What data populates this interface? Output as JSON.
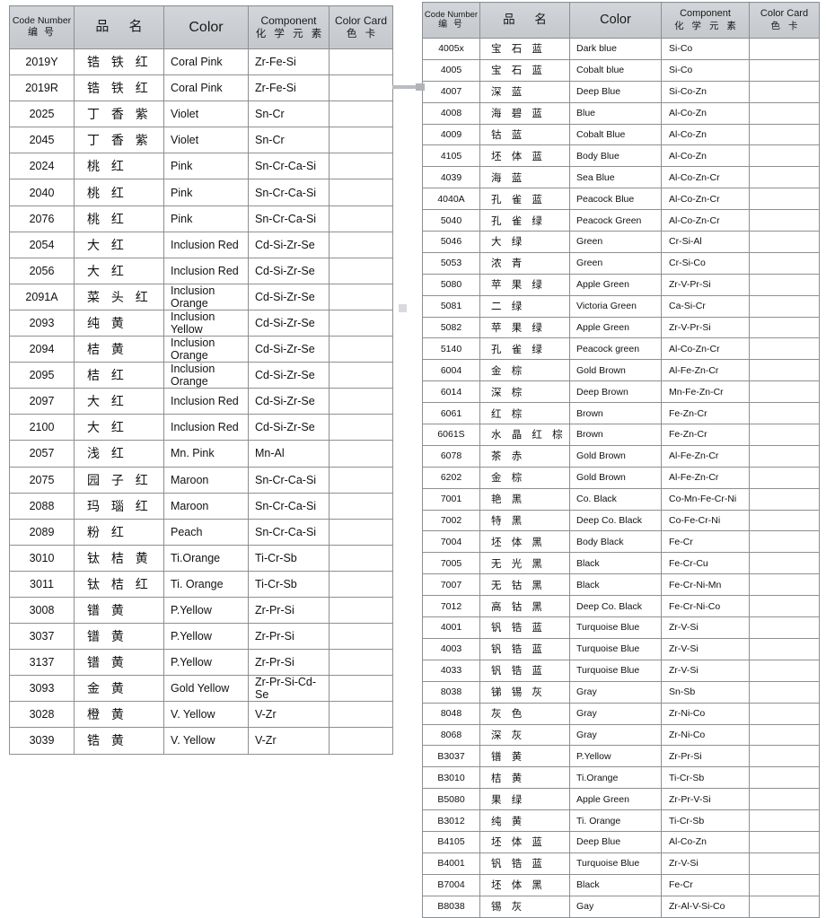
{
  "document": {
    "title": "Ceramic Pigment Color Chart",
    "tables": [
      {
        "id": "left-table",
        "headers": {
          "code": {
            "en": "Code Number",
            "cn": "编 号"
          },
          "name": {
            "en": "",
            "cn": "品    名"
          },
          "color": {
            "en": "Color",
            "cn": ""
          },
          "component": {
            "en": "Component",
            "cn": "化 学 元 素"
          },
          "card": {
            "en": "Color Card",
            "cn": "色 卡"
          }
        },
        "rows": [
          {
            "code": "2019Y",
            "name": "锆 铁 红",
            "color": "Coral Pink",
            "component": "Zr-Fe-Si",
            "swatch": "#c55a22"
          },
          {
            "code": "2019R",
            "name": "锆 铁 红",
            "color": "Coral Pink",
            "component": "Zr-Fe-Si",
            "swatch": "#c43b1c"
          },
          {
            "code": "2025",
            "name": "丁 香 紫",
            "color": "Violet",
            "component": "Sn-Cr",
            "swatch": "#a7689f"
          },
          {
            "code": "2045",
            "name": "丁 香 紫",
            "color": "Violet",
            "component": "Sn-Cr",
            "swatch": "#9b579b"
          },
          {
            "code": "2024",
            "name": "桃 红",
            "color": "Pink",
            "component": "Sn-Cr-Ca-Si",
            "swatch": "#f56098"
          },
          {
            "code": "2040",
            "name": "桃 红",
            "color": "Pink",
            "component": "Sn-Cr-Ca-Si",
            "swatch": "#ee6397"
          },
          {
            "code": "2076",
            "name": "桃 红",
            "color": "Pink",
            "component": "Sn-Cr-Ca-Si",
            "swatch": "#f584b2"
          },
          {
            "code": "2054",
            "name": "大 红",
            "color": "Inclusion Red",
            "component": "Cd-Si-Zr-Se",
            "swatch": "#ea1432"
          },
          {
            "code": "2056",
            "name": "大 红",
            "color": "Inclusion Red",
            "component": "Cd-Si-Zr-Se",
            "swatch": "#c4102c"
          },
          {
            "code": "2091A",
            "name": "菜 头 红",
            "color": "Inclusion Orange",
            "component": "Cd-Si-Zr-Se",
            "swatch": "#f6861f"
          },
          {
            "code": "2093",
            "name": "纯 黄",
            "color": "Inclusion Yellow",
            "component": "Cd-Si-Zr-Se",
            "swatch": "#fced00"
          },
          {
            "code": "2094",
            "name": "桔 黄",
            "color": "Inclusion Orange",
            "component": "Cd-Si-Zr-Se",
            "swatch": "#f8a01d"
          },
          {
            "code": "2095",
            "name": "桔 红",
            "color": "Inclusion Orange",
            "component": "Cd-Si-Zr-Se",
            "swatch": "#f47b20"
          },
          {
            "code": "2097",
            "name": "大 红",
            "color": "Inclusion Red",
            "component": "Cd-Si-Zr-Se",
            "swatch": "#ee1c25"
          },
          {
            "code": "2100",
            "name": "大 红",
            "color": "Inclusion Red",
            "component": "Cd-Si-Zr-Se",
            "swatch": "#ce1432"
          },
          {
            "code": "2057",
            "name": "浅 红",
            "color": "Mn. Pink",
            "component": "Mn-Al",
            "swatch": "#f7cbdd"
          },
          {
            "code": "2075",
            "name": "园 子 红",
            "color": "Maroon",
            "component": "Sn-Cr-Ca-Si",
            "swatch": "#b51c49"
          },
          {
            "code": "2088",
            "name": "玛 瑙 红",
            "color": "Maroon",
            "component": "Sn-Cr-Ca-Si",
            "swatch": "#a6153f"
          },
          {
            "code": "2089",
            "name": "粉 红",
            "color": "Peach",
            "component": "Sn-Cr-Ca-Si",
            "swatch": "#d06d8c"
          },
          {
            "code": "3010",
            "name": "钛 桔 黄",
            "color": "Ti.Orange",
            "component": "Ti-Cr-Sb",
            "swatch": "#f8ae1c"
          },
          {
            "code": "3011",
            "name": "钛 桔 红",
            "color": "Ti. Orange",
            "component": "Ti-Cr-Sb",
            "swatch": "#f59a19"
          },
          {
            "code": "3008",
            "name": "镨 黄",
            "color": "P.Yellow",
            "component": "Zr-Pr-Si",
            "swatch": "#fbeea2"
          },
          {
            "code": "3037",
            "name": "镨 黄",
            "color": "P.Yellow",
            "component": "Zr-Pr-Si",
            "swatch": "#fbe963"
          },
          {
            "code": "3137",
            "name": "镨 黄",
            "color": "P.Yellow",
            "component": "Zr-Pr-Si",
            "swatch": "#fcec00"
          },
          {
            "code": "3093",
            "name": "金 黄",
            "color": "Gold Yellow",
            "component": "Zr-Pr-Si-Cd-Se",
            "swatch": "#fbc502"
          },
          {
            "code": "3028",
            "name": "橙 黄",
            "color": "V. Yellow",
            "component": "V-Zr",
            "swatch": "#f9c764"
          },
          {
            "code": "3039",
            "name": "锆 黄",
            "color": "V. Yellow",
            "component": "V-Zr",
            "swatch": "#fad07b"
          }
        ]
      },
      {
        "id": "right-table",
        "headers": {
          "code": {
            "en": "Code Number",
            "cn": "编 号"
          },
          "name": {
            "en": "",
            "cn": "品    名"
          },
          "color": {
            "en": "Color",
            "cn": ""
          },
          "component": {
            "en": "Component",
            "cn": "化 学 元 素"
          },
          "card": {
            "en": "Color Card",
            "cn": "色 卡"
          }
        },
        "rows": [
          {
            "code": "4005x",
            "name": "宝 石 蓝",
            "color": "Dark blue",
            "component": "Si-Co",
            "swatch": "#3c2a9c"
          },
          {
            "code": "4005",
            "name": "宝 石 蓝",
            "color": "Cobalt blue",
            "component": "Si-Co",
            "swatch": "#3b2b98"
          },
          {
            "code": "4007",
            "name": "深 蓝",
            "color": "Deep Blue",
            "component": "Si-Co-Zn",
            "swatch": "#2e2a9a"
          },
          {
            "code": "4008",
            "name": "海 碧 蓝",
            "color": "Blue",
            "component": "Al-Co-Zn",
            "swatch": "#0d63ac"
          },
          {
            "code": "4009",
            "name": "钴 蓝",
            "color": "Cobalt Blue",
            "component": "Al-Co-Zn",
            "swatch": "#0a62a8"
          },
          {
            "code": "4105",
            "name": "坯 体 蓝",
            "color": "Body Blue",
            "component": "Al-Co-Zn",
            "swatch": "#2476c2"
          },
          {
            "code": "4039",
            "name": "海 蓝",
            "color": "Sea Blue",
            "component": "Al-Co-Zn-Cr",
            "swatch": "#0c7a9e"
          },
          {
            "code": "4040A",
            "name": "孔 雀 蓝",
            "color": "Peacock Blue",
            "component": "Al-Co-Zn-Cr",
            "swatch": "#1180a8"
          },
          {
            "code": "5040",
            "name": "孔 雀 绿",
            "color": "Peacock Green",
            "component": "Al-Co-Zn-Cr",
            "swatch": "#046e4f"
          },
          {
            "code": "5046",
            "name": "大 绿",
            "color": "Green",
            "component": "Cr-Si-Al",
            "swatch": "#548f63"
          },
          {
            "code": "5053",
            "name": "浓 青",
            "color": "Green",
            "component": "Cr-Si-Co",
            "swatch": "#55ad9f"
          },
          {
            "code": "5080",
            "name": "苹 果 绿",
            "color": "Apple Green",
            "component": "Zr-V-Pr-Si",
            "swatch": "#5fbd48"
          },
          {
            "code": "5081",
            "name": "二 绿",
            "color": "Victoria Green",
            "component": "Ca-Si-Cr",
            "swatch": "#a6ca3c"
          },
          {
            "code": "5082",
            "name": "苹 果 绿",
            "color": "Apple Green",
            "component": "Zr-V-Pr-Si",
            "swatch": "#66c14a"
          },
          {
            "code": "5140",
            "name": "孔 雀 绿",
            "color": "Peacock green",
            "component": "Al-Co-Zn-Cr",
            "swatch": "#04734d"
          },
          {
            "code": "6004",
            "name": "金 棕",
            "color": "Gold Brown",
            "component": "Al-Fe-Zn-Cr",
            "swatch": "#e09a10"
          },
          {
            "code": "6014",
            "name": "深 棕",
            "color": "Deep Brown",
            "component": "Mn-Fe-Zn-Cr",
            "swatch": "#3e1c06"
          },
          {
            "code": "6061",
            "name": "红 棕",
            "color": "Brown",
            "component": "Fe-Zn-Cr",
            "swatch": "#7b2d1d"
          },
          {
            "code": "6061S",
            "name": "水 晶 红 棕",
            "color": "Brown",
            "component": "Fe-Zn-Cr",
            "swatch": "#7c351d"
          },
          {
            "code": "6078",
            "name": "茶 赤",
            "color": "Gold Brown",
            "component": "Al-Fe-Zn-Cr",
            "swatch": "#d4751b"
          },
          {
            "code": "6202",
            "name": "金 棕",
            "color": "Gold Brown",
            "component": "Al-Fe-Zn-Cr",
            "swatch": "#cf5e18"
          },
          {
            "code": "7001",
            "name": "艳 黑",
            "color": "Co. Black",
            "component": "Co-Mn-Fe-Cr-Ni",
            "swatch": "#2f2f2f"
          },
          {
            "code": "7002",
            "name": "特 黑",
            "color": "Deep Co. Black",
            "component": "Co-Fe-Cr-Ni",
            "swatch": "#241f1f"
          },
          {
            "code": "7004",
            "name": "坯 体 黑",
            "color": "Body Black",
            "component": "Fe-Cr",
            "swatch": "#3f3037"
          },
          {
            "code": "7005",
            "name": "无 光 黑",
            "color": "Black",
            "component": "Fe-Cr-Cu",
            "swatch": "#331f22"
          },
          {
            "code": "7007",
            "name": "无 钴 黑",
            "color": "Black",
            "component": "Fe-Cr-Ni-Mn",
            "swatch": "#261619"
          },
          {
            "code": "7012",
            "name": "高 钴 黑",
            "color": "Deep Co. Black",
            "component": "Fe-Cr-Ni-Co",
            "swatch": "#16100f"
          },
          {
            "code": "4001",
            "name": "钒 锆 蓝",
            "color": "Turquoise Blue",
            "component": "Zr-V-Si",
            "swatch": "#72cdf0"
          },
          {
            "code": "4003",
            "name": "钒 锆 蓝",
            "color": "Turquoise Blue",
            "component": "Zr-V-Si",
            "swatch": "#0aa3e2"
          },
          {
            "code": "4033",
            "name": "钒 锆 蓝",
            "color": "Turquoise Blue",
            "component": "Zr-V-Si",
            "swatch": "#45c1ee"
          },
          {
            "code": "8038",
            "name": "锑 锡 灰",
            "color": "Gray",
            "component": "Sn-Sb",
            "swatch": "#6d8089"
          },
          {
            "code": "8048",
            "name": "灰 色",
            "color": "Gray",
            "component": "Zr-Ni-Co",
            "swatch": "#6a6e72"
          },
          {
            "code": "8068",
            "name": "深 灰",
            "color": "Gray",
            "component": "Zr-Ni-Co",
            "swatch": "#565d63"
          },
          {
            "code": "B3037",
            "name": "镨 黄",
            "color": "P.Yellow",
            "component": "Zr-Pr-Si",
            "swatch": "#fbe220"
          },
          {
            "code": "B3010",
            "name": "桔 黄",
            "color": "Ti.Orange",
            "component": "Ti-Cr-Sb",
            "swatch": "#fcc110"
          },
          {
            "code": "B5080",
            "name": "果 绿",
            "color": "Apple Green",
            "component": "Zr-Pr-V-Si",
            "swatch": "#7cb73e"
          },
          {
            "code": "B3012",
            "name": "纯 黄",
            "color": "Ti. Orange",
            "component": "Ti-Cr-Sb",
            "swatch": "#fcc314"
          },
          {
            "code": "B4105",
            "name": "坯 体 蓝",
            "color": "Deep Blue",
            "component": "Al-Co-Zn",
            "swatch": "#0c9ddc"
          },
          {
            "code": "B4001",
            "name": "钒 锆 蓝",
            "color": "Turquoise Blue",
            "component": "Zr-V-Si",
            "swatch": "#41c2ef"
          },
          {
            "code": "B7004",
            "name": "坯 体 黑",
            "color": "Black",
            "component": "Fe-Cr",
            "swatch": "#17171a"
          },
          {
            "code": "B8038",
            "name": "锡 灰",
            "color": "Gay",
            "component": "Zr-Al-V-Si-Co",
            "swatch": "#6b8490"
          }
        ]
      }
    ]
  }
}
